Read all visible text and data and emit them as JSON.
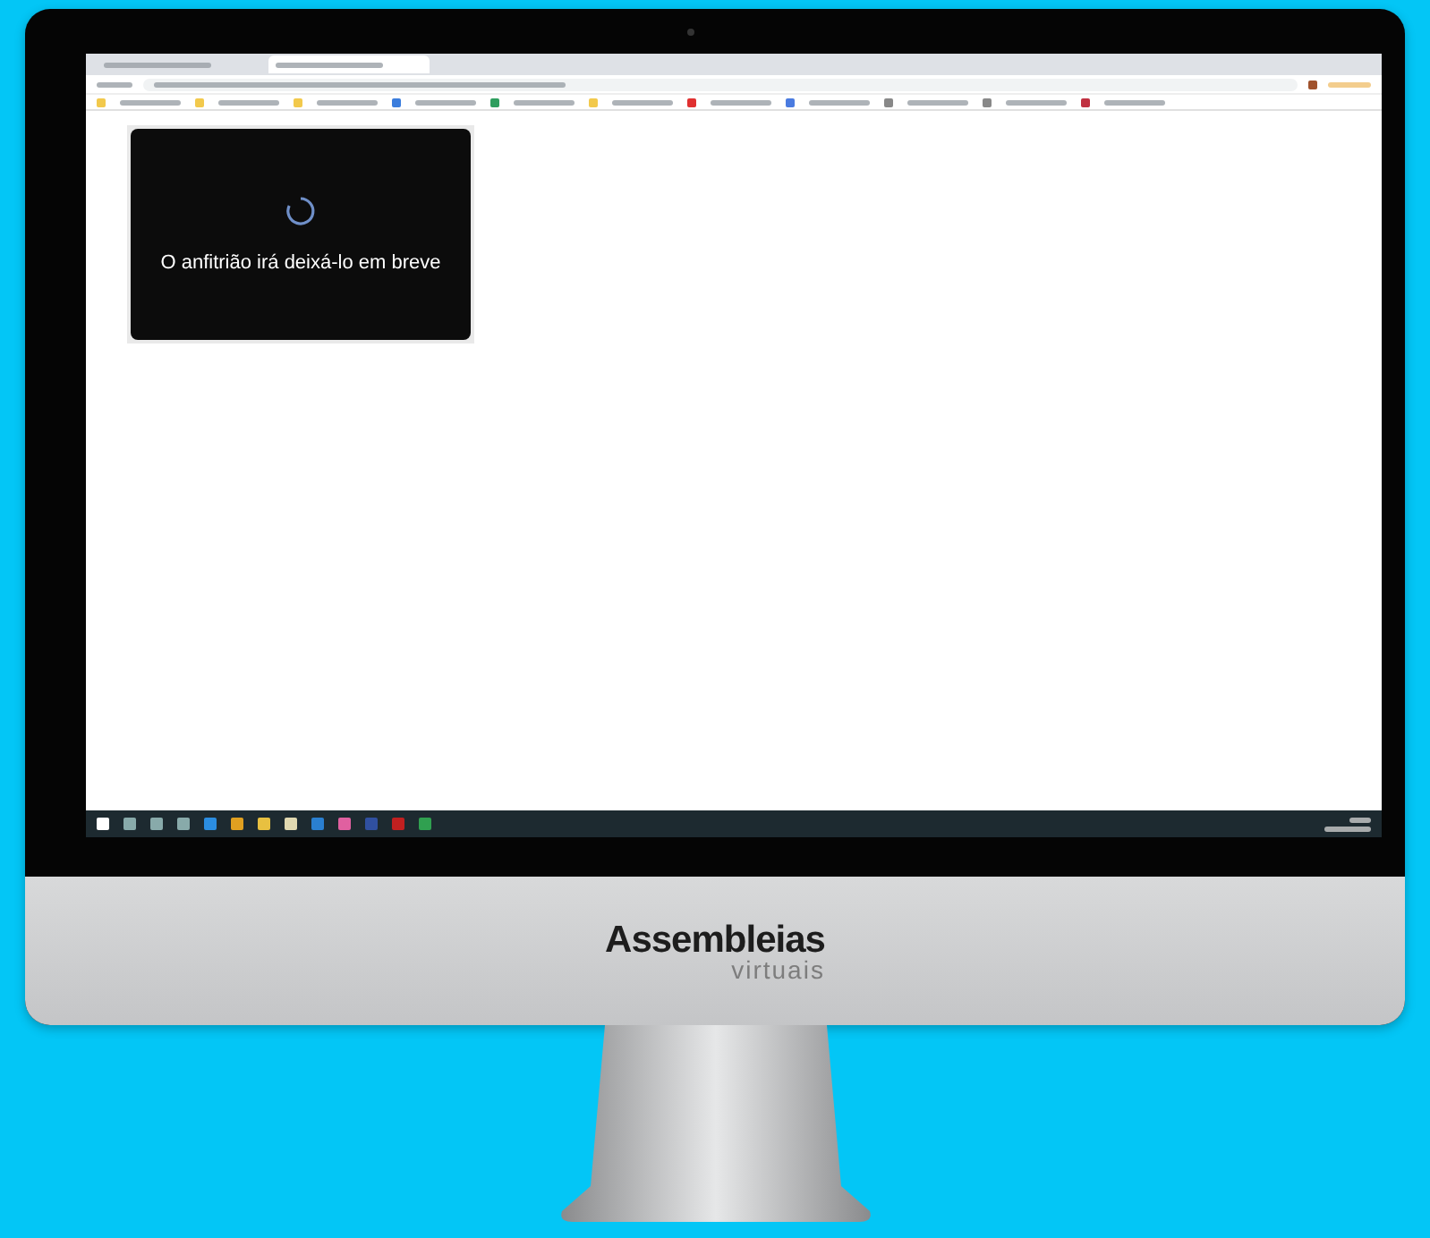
{
  "screen": {
    "dialog": {
      "message": "O anfitrião irá deixá-lo em breve"
    }
  },
  "brand": {
    "name": "Assembleias",
    "tagline": "virtuais"
  }
}
